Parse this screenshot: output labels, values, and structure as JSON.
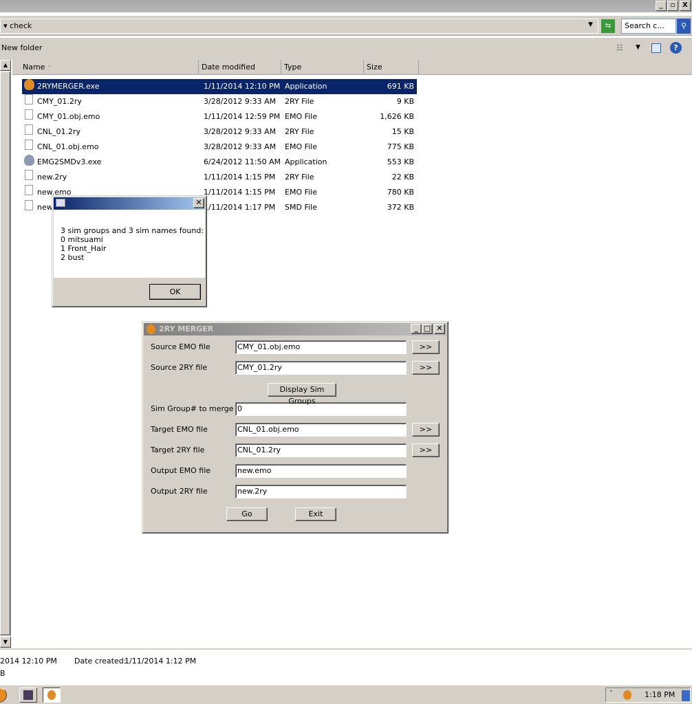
{
  "explorer": {
    "address": "check",
    "search_placeholder": "Search c...",
    "toolbar": {
      "new_folder": "New folder"
    },
    "columns": [
      "Name",
      "Date modified",
      "Type",
      "Size"
    ],
    "files": [
      {
        "name": "2RYMERGER.exe",
        "date": "1/11/2014 12:10 PM",
        "type": "Application",
        "size": "691 KB",
        "icon": "app-icon",
        "selected": true
      },
      {
        "name": "CMY_01.2ry",
        "date": "3/28/2012 9:33 AM",
        "type": "2RY File",
        "size": "9 KB",
        "icon": "file-icon"
      },
      {
        "name": "CMY_01.obj.emo",
        "date": "1/11/2014 12:59 PM",
        "type": "EMO File",
        "size": "1,626 KB",
        "icon": "file-icon"
      },
      {
        "name": "CNL_01.2ry",
        "date": "3/28/2012 9:33 AM",
        "type": "2RY File",
        "size": "15 KB",
        "icon": "file-icon"
      },
      {
        "name": "CNL_01.obj.emo",
        "date": "3/28/2012 9:33 AM",
        "type": "EMO File",
        "size": "775 KB",
        "icon": "file-icon"
      },
      {
        "name": "EMG2SMDv3.exe",
        "date": "6/24/2012 11:50 AM",
        "type": "Application",
        "size": "553 KB",
        "icon": "app-icon"
      },
      {
        "name": "new.2ry",
        "date": "1/11/2014 1:15 PM",
        "type": "2RY File",
        "size": "22 KB",
        "icon": "file-icon"
      },
      {
        "name": "new.emo",
        "date": "1/11/2014 1:15 PM",
        "type": "EMO File",
        "size": "780 KB",
        "icon": "file-icon"
      },
      {
        "name": "new",
        "date": "1/11/2014 1:17 PM",
        "type": "SMD File",
        "size": "372 KB",
        "icon": "file-icon"
      }
    ],
    "details": {
      "modified": "2014 12:10 PM",
      "created_label": "Date created:",
      "created": "1/11/2014 1:12 PM",
      "size": "B"
    }
  },
  "msgbox": {
    "lines": [
      "3 sim groups and 3 sim names found:",
      "0 mitsuami",
      "1 Front_Hair",
      "2 bust"
    ],
    "ok": "OK"
  },
  "merger": {
    "title": "2RY MERGER",
    "fields": [
      {
        "label": "Source EMO file",
        "value": "CMY_01.obj.emo",
        "browse": ">>"
      },
      {
        "label": "Source 2RY file",
        "value": "CMY_01.2ry",
        "browse": ">>"
      },
      {
        "label": "Sim Group# to merge",
        "value": "0"
      },
      {
        "label": "Target EMO file",
        "value": "CNL_01.obj.emo",
        "browse": ">>"
      },
      {
        "label": "Target 2RY file",
        "value": "CNL_01.2ry",
        "browse": ">>"
      },
      {
        "label": "Output EMO file",
        "value": "new.emo"
      },
      {
        "label": "Output 2RY file",
        "value": "new.2ry"
      }
    ],
    "display_button": "Display Sim Groups",
    "go": "Go",
    "exit": "Exit"
  },
  "taskbar": {
    "clock": "1:18 PM"
  }
}
